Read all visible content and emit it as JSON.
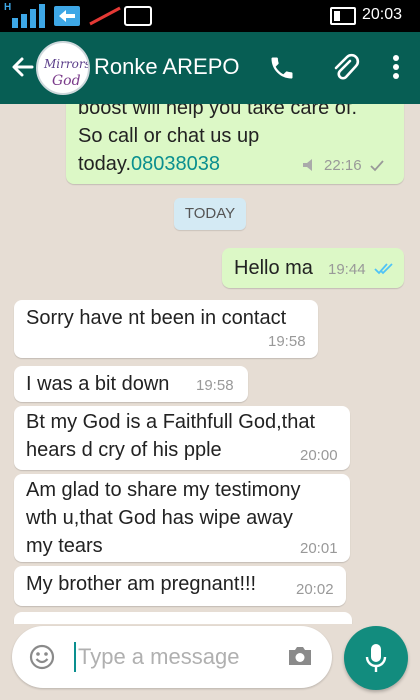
{
  "status_bar": {
    "time": "20:03",
    "network_letter": "H"
  },
  "header": {
    "contact_name": "Ronke AREPO",
    "avatar_text_1": "Mirrors",
    "avatar_text_2": "God"
  },
  "messages": [
    {
      "lines": [
        "boost will help you take care of.",
        "So call or chat us up",
        "today."
      ],
      "link": "08038038",
      "time": "22:16",
      "direction": "out"
    },
    {
      "lines": [
        "Hello ma"
      ],
      "time": "19:44",
      "direction": "out"
    },
    {
      "lines": [
        "Sorry have nt been in contact"
      ],
      "time": "19:58",
      "direction": "in"
    },
    {
      "lines": [
        "I was a bit down"
      ],
      "time": "19:58",
      "direction": "in"
    },
    {
      "lines": [
        "Bt my God is a Faithfull God,that",
        "hears d cry of his pple"
      ],
      "time": "20:00",
      "direction": "in"
    },
    {
      "lines": [
        "Am glad to share my testimony",
        "wth u,that God has wipe away",
        "my tears"
      ],
      "time": "20:01",
      "direction": "in"
    },
    {
      "lines": [
        "My brother am pregnant!!!"
      ],
      "time": "20:02",
      "direction": "in"
    }
  ],
  "date_divider": "TODAY",
  "input": {
    "placeholder": "Type a message"
  },
  "colors": {
    "header": "#075e54",
    "accent": "#128c7e",
    "outgoing_bubble": "#dcf8c6",
    "tick_read": "#4fc3f7"
  }
}
